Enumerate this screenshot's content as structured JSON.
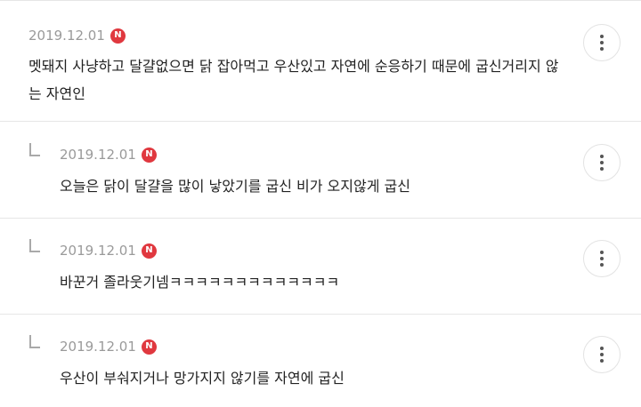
{
  "comments": [
    {
      "date": "2019.12.01",
      "badge": "N",
      "text": "멧돼지 사냥하고 달걀없으면 닭 잡아먹고 우산있고 자연에 순응하기 때문에 굽신거리지 않는 자연인",
      "is_reply": false
    },
    {
      "date": "2019.12.01",
      "badge": "N",
      "text": "오늘은 닭이 달걀을 많이 낳았기를 굽신 비가 오지않게 굽신",
      "is_reply": true
    },
    {
      "date": "2019.12.01",
      "badge": "N",
      "text": "바꾼거 졸라웃기넴ㅋㅋㅋㅋㅋㅋㅋㅋㅋㅋㅋㅋㅋ",
      "is_reply": true
    },
    {
      "date": "2019.12.01",
      "badge": "N",
      "text": "우산이 부숴지거나 망가지지 않기를 자연에 굽신",
      "is_reply": true
    }
  ]
}
